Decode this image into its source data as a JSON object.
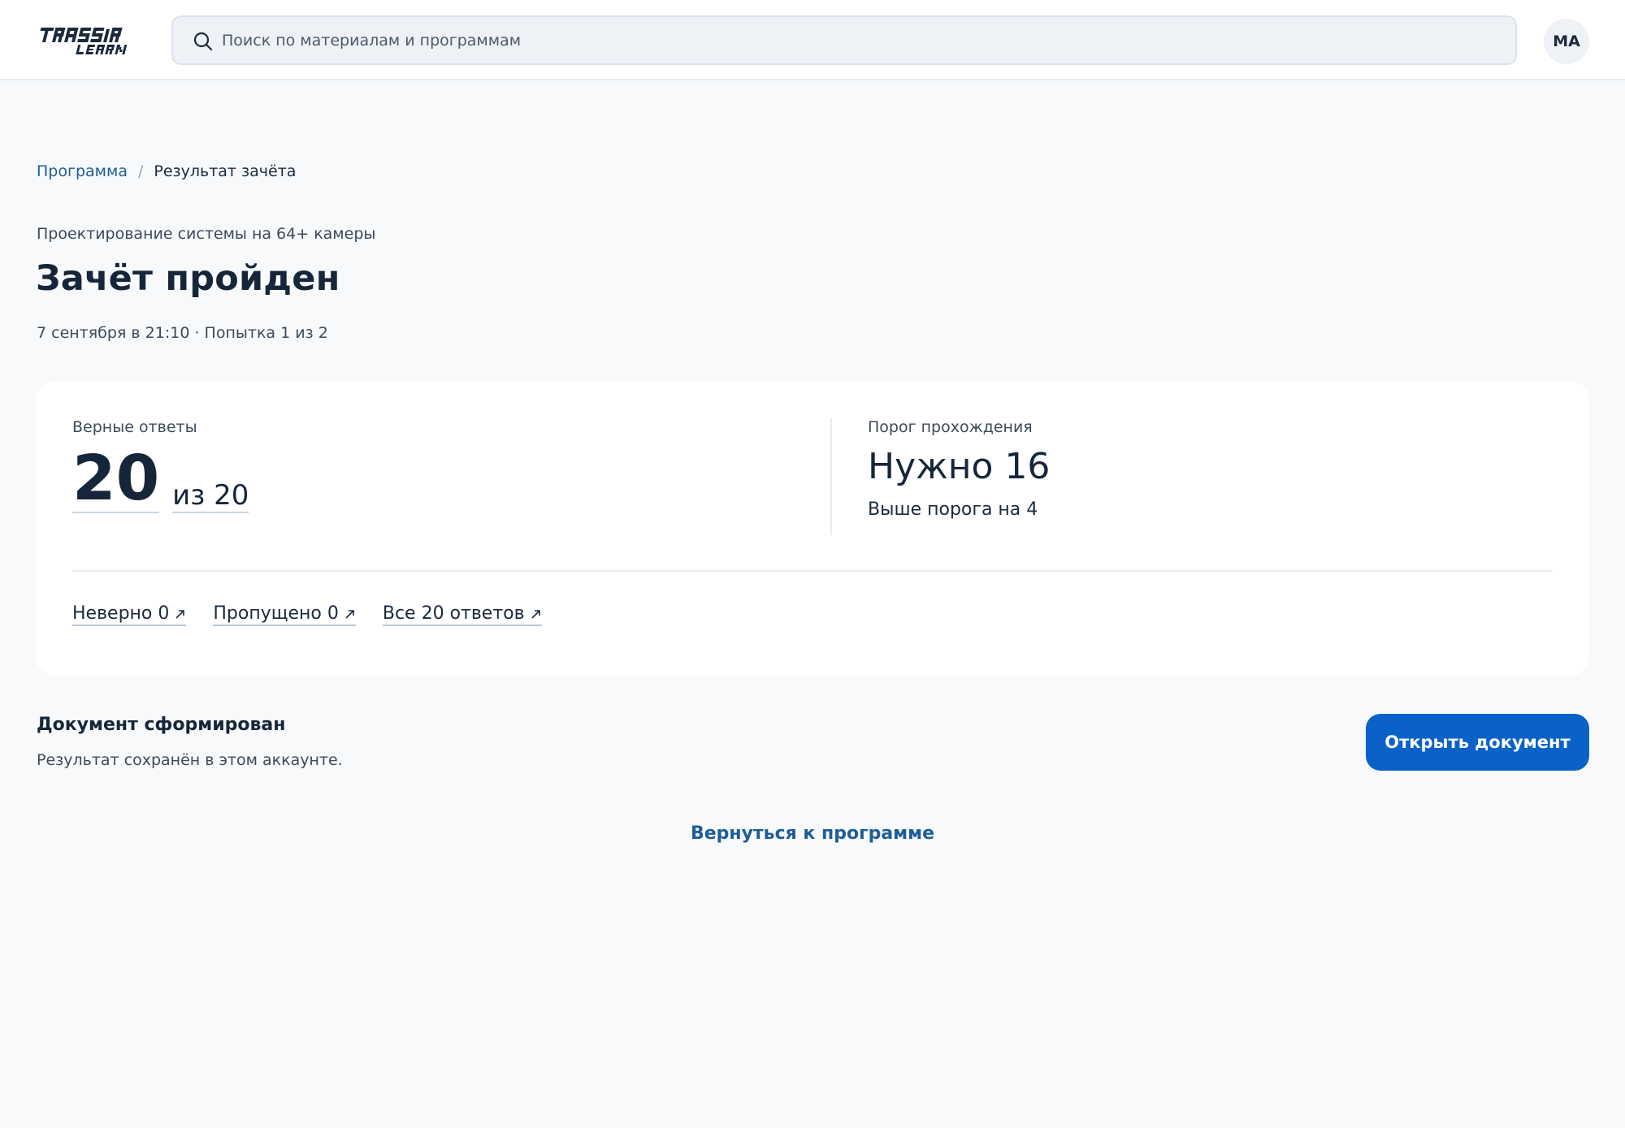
{
  "header": {
    "logo_icon": "trassir-learn-logo",
    "search": {
      "placeholder": "Поиск по материалам и программам",
      "value": "",
      "icon": "search-icon"
    },
    "avatar_initials": "MA"
  },
  "breadcrumb": {
    "items": [
      "Программа",
      "Результат зачёта"
    ],
    "separator": "/"
  },
  "main": {
    "program_name": "Проектирование системы на 64+ камеры",
    "title": "Зачёт пройден",
    "meta": "7 сентября в 21:10 · Попытка 1 из 2"
  },
  "result_card": {
    "correct": {
      "label": "Верные ответы",
      "value": "20",
      "of_text": "из 20"
    },
    "threshold": {
      "label": "Порог прохождения",
      "value": "Нужно 16",
      "note": "Выше порога на 4"
    },
    "filters": [
      {
        "label": "Неверно 0",
        "icon": "external-arrow-icon"
      },
      {
        "label": "Пропущено 0",
        "icon": "external-arrow-icon"
      },
      {
        "label": "Все 20 ответов",
        "icon": "external-arrow-icon"
      }
    ]
  },
  "document": {
    "title": "Документ сформирован",
    "subtitle": "Результат сохранён в этом аккаунте.",
    "button_label": "Открыть документ"
  },
  "back_link": "Вернуться к программе",
  "colors": {
    "accent": "#0a62c9",
    "link": "#1f5d95",
    "background": "#f7f9fb",
    "text": "#16263a"
  }
}
